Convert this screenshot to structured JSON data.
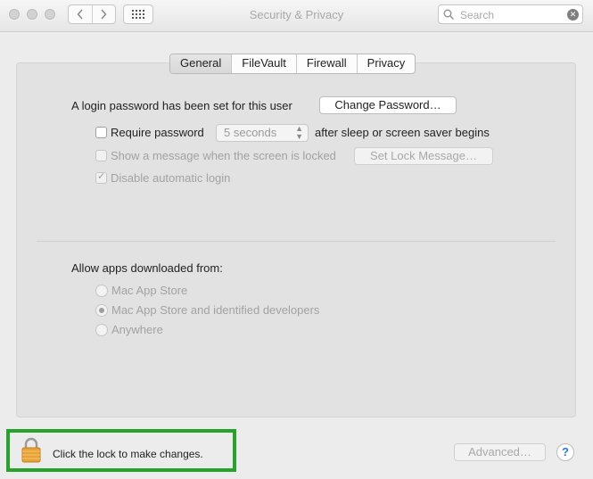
{
  "window": {
    "title": "Security & Privacy"
  },
  "toolbar": {
    "back_icon": "chevron-left-icon",
    "forward_icon": "chevron-right-icon",
    "grid_icon": "show-all-grid-icon"
  },
  "search": {
    "placeholder": "Search",
    "value": ""
  },
  "tabs": [
    {
      "label": "General",
      "active": true
    },
    {
      "label": "FileVault",
      "active": false
    },
    {
      "label": "Firewall",
      "active": false
    },
    {
      "label": "Privacy",
      "active": false
    }
  ],
  "general": {
    "login_text": "A login password has been set for this user",
    "change_password_button": "Change Password…",
    "require_password": {
      "label": "Require password",
      "checked": false,
      "delay": "5 seconds",
      "suffix": "after sleep or screen saver begins"
    },
    "show_message": {
      "label": "Show a message when the screen is locked",
      "checked": false,
      "button": "Set Lock Message…"
    },
    "disable_auto_login": {
      "label": "Disable automatic login",
      "checked": true
    },
    "allow_apps": {
      "heading": "Allow apps downloaded from:",
      "options": [
        {
          "label": "Mac App Store",
          "selected": false
        },
        {
          "label": "Mac App Store and identified developers",
          "selected": true
        },
        {
          "label": "Anywhere",
          "selected": false
        }
      ]
    }
  },
  "footer": {
    "lock_label": "Click the lock to make changes.",
    "advanced_button": "Advanced…",
    "help_button": "?",
    "highlight_color": "#27a22b"
  }
}
